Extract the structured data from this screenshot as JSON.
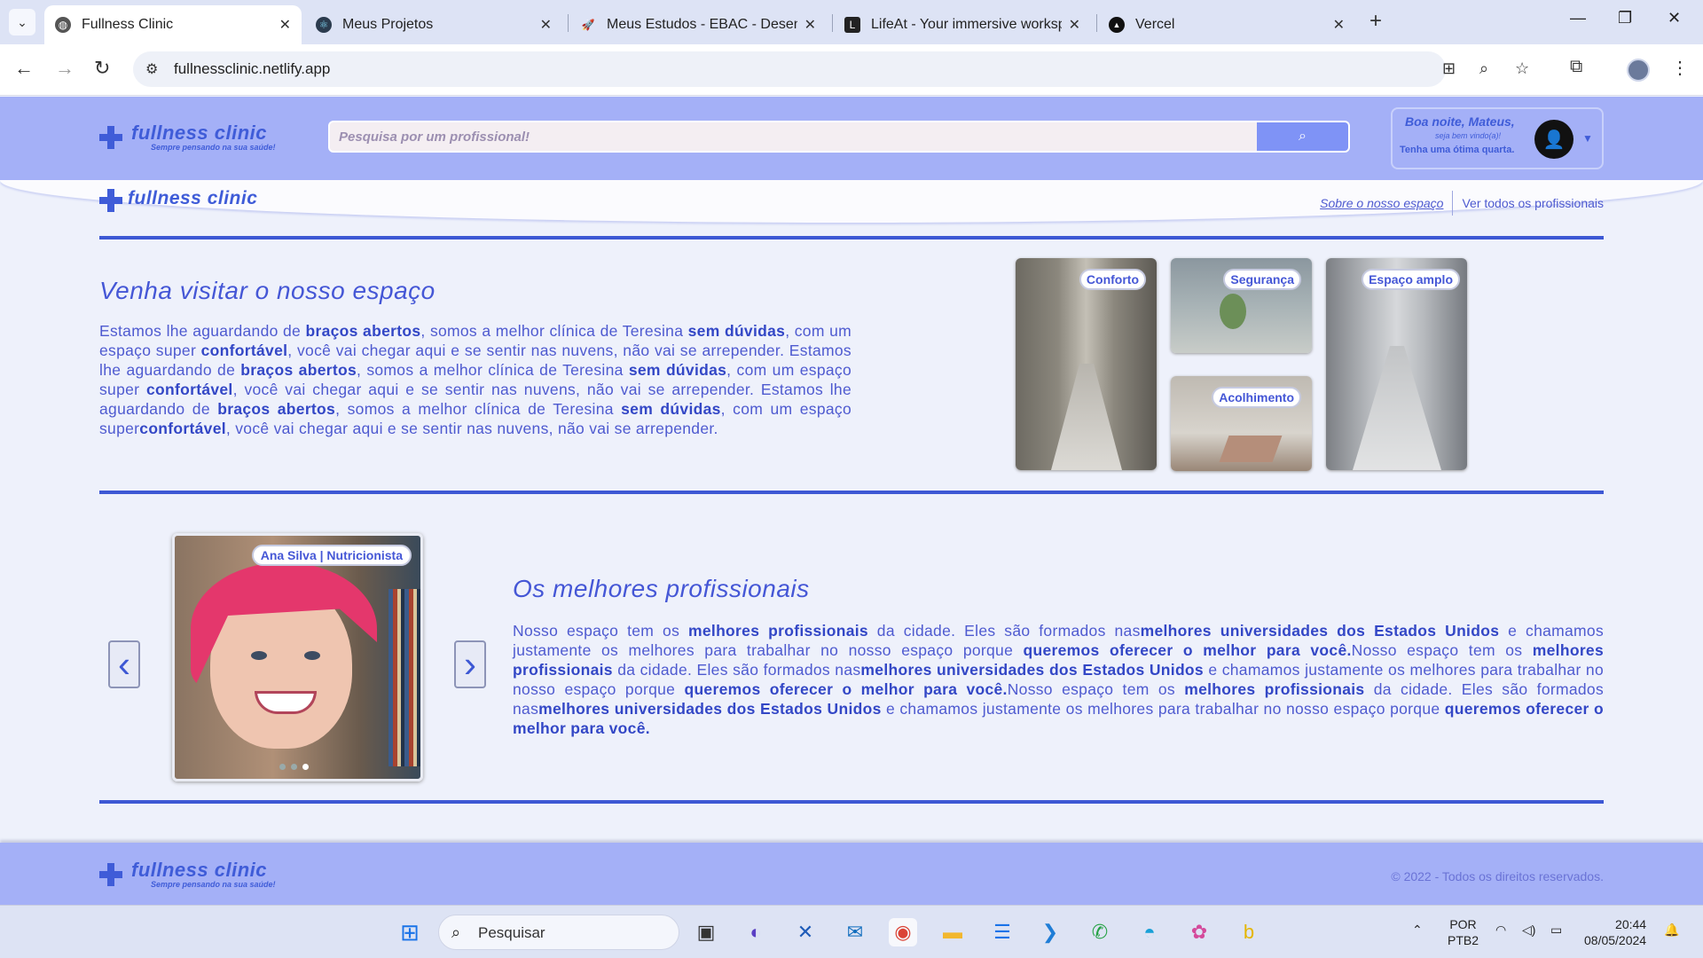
{
  "browser": {
    "tabs": [
      {
        "title": "Fullness Clinic",
        "icon": "globe-icon",
        "active": true
      },
      {
        "title": "Meus Projetos",
        "icon": "react-icon"
      },
      {
        "title": "Meus Estudos - EBAC - Desenvo",
        "icon": "rocket-icon"
      },
      {
        "title": "LifeAt - Your immersive worksp",
        "icon": "lifeat-icon"
      },
      {
        "title": "Vercel",
        "icon": "vercel-icon"
      }
    ],
    "url": "fullnessclinic.netlify.app"
  },
  "header": {
    "logo_text": "fullness clinic",
    "logo_slogan": "Sempre pensando na sua saúde!",
    "search_placeholder": "Pesquisa por um profissional!",
    "greeting": "Boa noite, Mateus,",
    "greeting_sub": "seja bem vindo(a)!",
    "greeting_msg": "Tenha uma ótima quarta."
  },
  "nav": {
    "logo_text": "fullness clinic",
    "link_about": "Sobre o nosso espaço",
    "link_all": "Ver todos os profissionais"
  },
  "space": {
    "title": "Venha visitar o nosso espaço",
    "paragraph": [
      {
        "t": "Estamos lhe aguardando de "
      },
      {
        "t": "braços abertos",
        "b": true
      },
      {
        "t": ", somos a melhor clínica de Teresina "
      },
      {
        "t": "sem dúvidas",
        "b": true
      },
      {
        "t": ", com um espaço super "
      },
      {
        "t": "confortável",
        "b": true
      },
      {
        "t": ", você vai chegar aqui e se sentir nas nuvens, não vai se arrepender. Estamos lhe aguardando de "
      },
      {
        "t": "braços abertos",
        "b": true
      },
      {
        "t": ", somos a melhor clínica de Teresina "
      },
      {
        "t": "sem dúvidas",
        "b": true
      },
      {
        "t": ", com um espaço super "
      },
      {
        "t": "confortável",
        "b": true
      },
      {
        "t": ", você vai chegar aqui e se sentir nas nuvens, não vai se arrepender. Estamos lhe aguardando de "
      },
      {
        "t": "braços abertos",
        "b": true
      },
      {
        "t": ", somos a melhor clínica de Teresina "
      },
      {
        "t": "sem dúvidas",
        "b": true
      },
      {
        "t": ", com um espaço super"
      },
      {
        "t": "confortável",
        "b": true
      },
      {
        "t": ", você vai chegar aqui e se sentir nas nuvens, não vai se arrepender."
      }
    ],
    "photos": [
      "Conforto",
      "Segurança",
      "Acolhimento",
      "Espaço amplo"
    ]
  },
  "professionals": {
    "title": "Os melhores profissionais",
    "card_tag": "Ana Silva | Nutricionista",
    "paragraph": [
      {
        "t": "Nosso espaço tem os "
      },
      {
        "t": "melhores profissionais",
        "b": true
      },
      {
        "t": " da cidade. Eles são formados nas"
      },
      {
        "t": "melhores universidades dos Estados Unidos",
        "b": true
      },
      {
        "t": " e chamamos justamente os melhores para trabalhar no nosso espaço porque "
      },
      {
        "t": "queremos oferecer o melhor para você.",
        "b": true
      },
      {
        "t": "Nosso espaço tem os "
      },
      {
        "t": "melhores profissionais",
        "b": true
      },
      {
        "t": " da cidade. Eles são formados nas"
      },
      {
        "t": "melhores universidades dos Estados Unidos",
        "b": true
      },
      {
        "t": " e chamamos justamente os melhores para trabalhar no nosso espaço porque "
      },
      {
        "t": "queremos oferecer o melhor para você.",
        "b": true
      },
      {
        "t": "Nosso espaço tem os "
      },
      {
        "t": "melhores profissionais",
        "b": true
      },
      {
        "t": " da cidade. Eles são formados nas"
      },
      {
        "t": "melhores universidades dos Estados Unidos",
        "b": true
      },
      {
        "t": " e chamamos justamente os melhores para trabalhar no nosso espaço porque "
      },
      {
        "t": "queremos oferecer o melhor para você.",
        "b": true
      }
    ],
    "prev_glyph": "‹",
    "next_glyph": "›"
  },
  "footer": {
    "logo_text": "fullness clinic",
    "logo_slogan": "Sempre pensando na sua saúde!",
    "copyright": "© 2022 - Todos os direitos reservados."
  },
  "taskbar": {
    "search_label": "Pesquisar",
    "lang_top": "POR",
    "lang_bottom": "PTB2",
    "time": "20:44",
    "date": "08/05/2024"
  },
  "colors": {
    "brand": "#3f5cd8",
    "header_bg": "#a4b0f7",
    "text": "#4e5ad0"
  }
}
